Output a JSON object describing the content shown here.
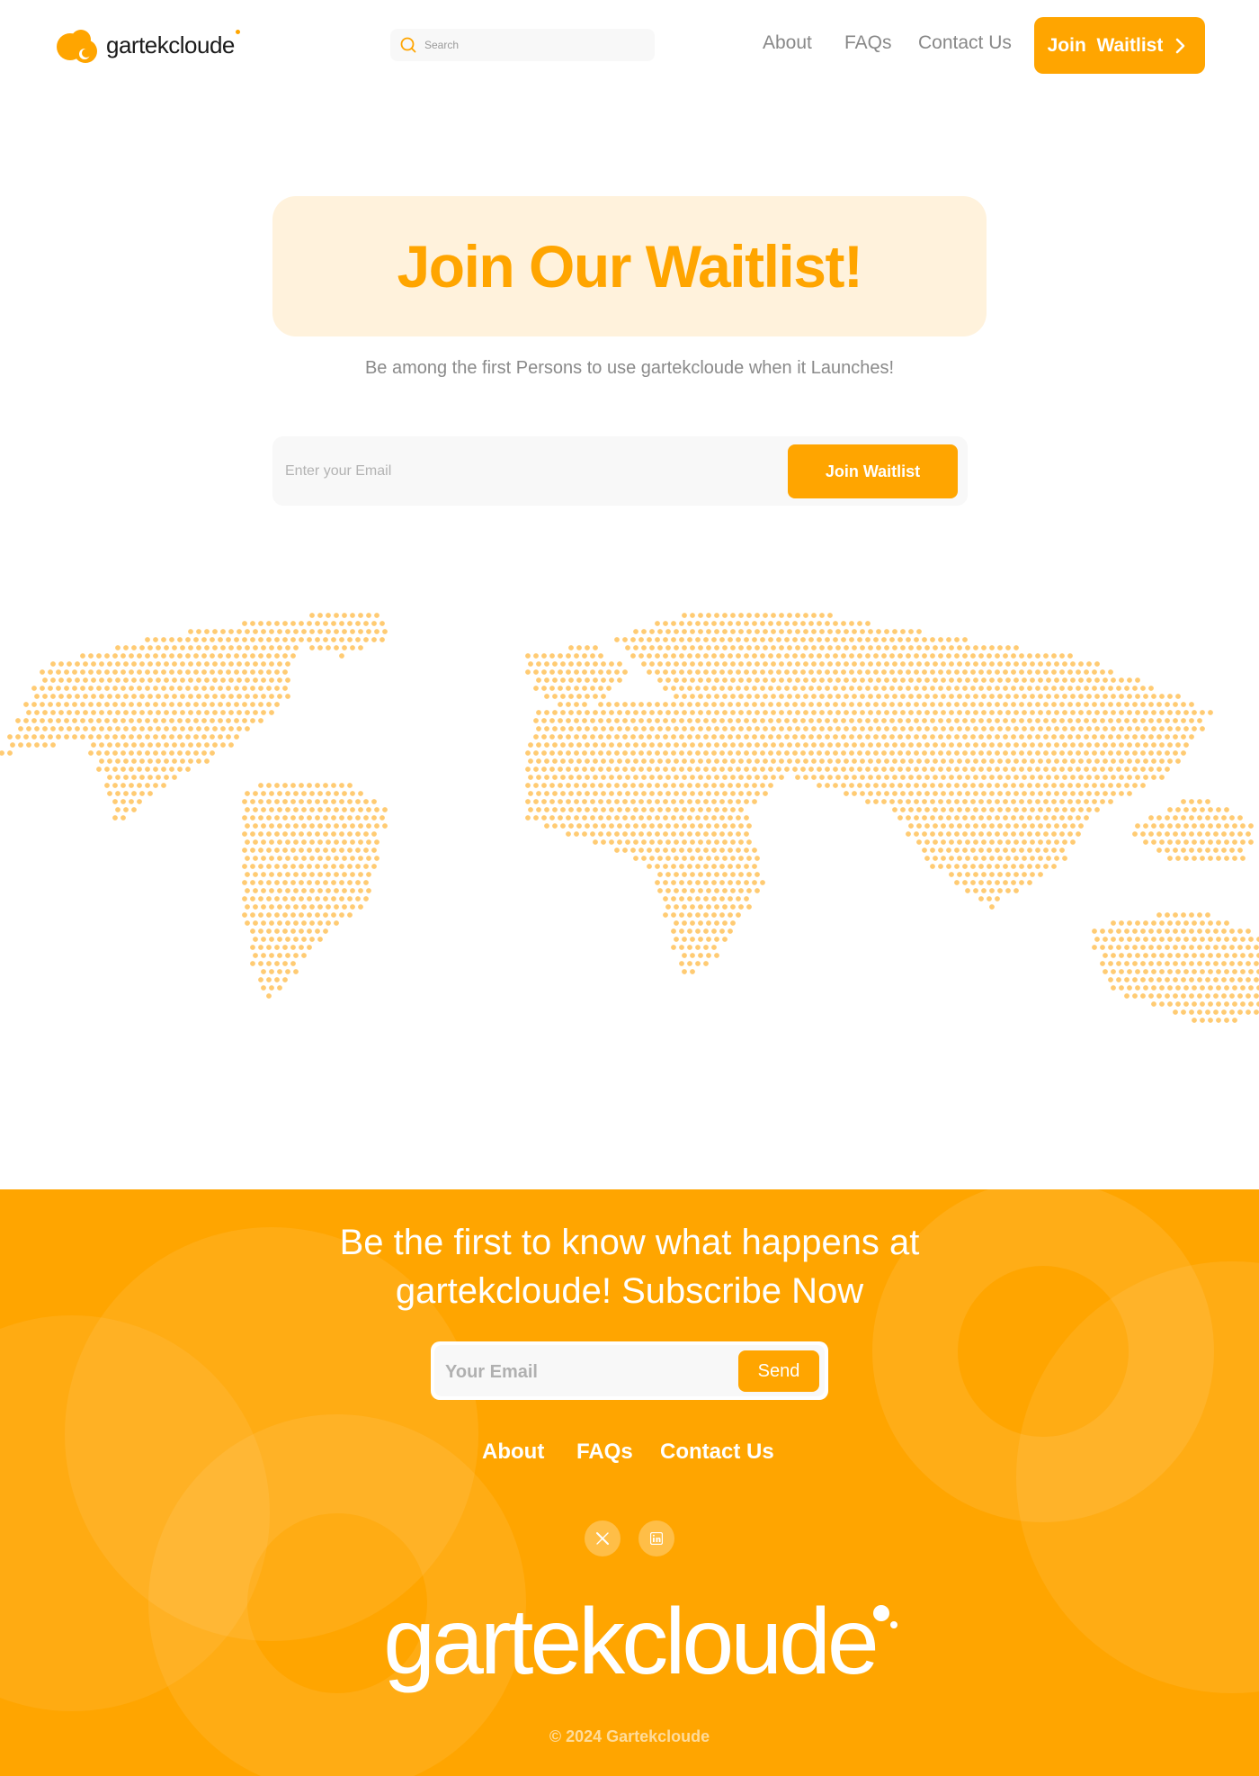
{
  "brand": {
    "name": "gartekcloude",
    "accent_color": "#FFA500",
    "tint_color": "#FFF2DC"
  },
  "header": {
    "search": {
      "placeholder": "Search",
      "icon": "search-icon"
    },
    "nav": {
      "about": "About",
      "faqs": "FAQs",
      "contact": "Contact Us"
    },
    "cta": {
      "label": "Join  Waitlist",
      "icon": "chevron-right-icon"
    }
  },
  "hero": {
    "title": "Join Our Waitlist!",
    "subtitle": "Be among the first Persons to use gartekcloude when it Launches!",
    "email_placeholder": "Enter your Email",
    "button_label": "Join Waitlist"
  },
  "map": {
    "icon": "dotted-world-map",
    "dot_color": "#FFCB73"
  },
  "footer": {
    "title_line1": "Be the first to know what happens at",
    "title_line2": "gartekcloude! Subscribe Now",
    "email_placeholder": "Your Email",
    "send_label": "Send",
    "links": {
      "about": "About",
      "faqs": "FAQs",
      "contact": "Contact Us"
    },
    "social": [
      "x-icon",
      "linkedin-icon"
    ],
    "wordmark": "gartekcloude",
    "copyright": "© 2024 Gartekcloude"
  }
}
